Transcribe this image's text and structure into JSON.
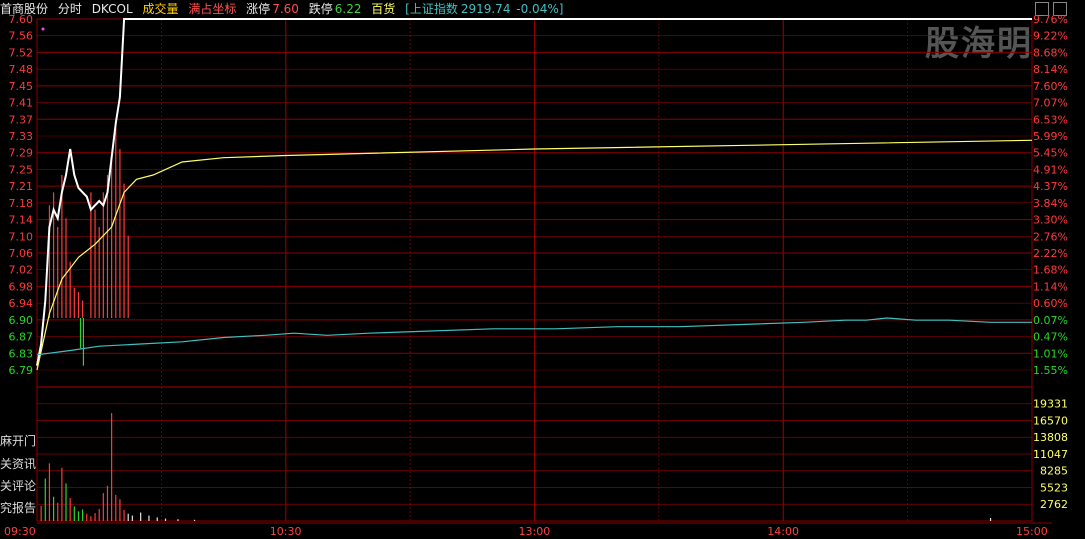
{
  "header": {
    "stock_name": "首商股份",
    "mode": "分时",
    "indicator": "DKCOL",
    "volume_label": "成交量",
    "full_axis": "满占坐标",
    "limit_up_label": "涨停",
    "limit_up": "7.60",
    "limit_down_label": "跌停",
    "limit_down": "6.22",
    "sector": "百货",
    "index_label": "[上证指数",
    "index_value": "2919.74",
    "index_change": "-0.04%]"
  },
  "watermark": "股海明",
  "side_links": [
    "麻开门",
    "关资讯",
    "关评论",
    "究报告"
  ],
  "colors": {
    "background": "#000000",
    "grid": "#8b0000",
    "price_line": "#ffffff",
    "avg_line": "#ffff66",
    "index_line": "#40c0c0",
    "up": "#ff3b3b",
    "down": "#29d629",
    "axis_text_up": "#ff3b3b",
    "axis_text_down": "#29d629",
    "time_text": "#ff4040"
  },
  "chart_data": {
    "type": "line",
    "price_axis": {
      "ticks": [
        "7.60",
        "7.56",
        "7.52",
        "7.48",
        "7.45",
        "7.41",
        "7.37",
        "7.33",
        "7.29",
        "7.25",
        "7.21",
        "7.18",
        "7.14",
        "7.10",
        "7.06",
        "7.02",
        "6.98",
        "6.94",
        "6.90",
        "6.87",
        "6.83",
        "6.79"
      ],
      "ylim": [
        6.79,
        7.6
      ],
      "prev_close": 6.91
    },
    "percent_axis": {
      "ticks": [
        "9.76%",
        "9.22%",
        "8.68%",
        "8.14%",
        "7.60%",
        "7.07%",
        "6.53%",
        "5.99%",
        "5.45%",
        "4.91%",
        "4.37%",
        "3.84%",
        "3.30%",
        "2.76%",
        "2.22%",
        "1.68%",
        "1.14%",
        "0.60%",
        "0.07%",
        "0.47%",
        "1.01%",
        "1.55%"
      ]
    },
    "volume_axis": {
      "ticks": [
        "19331",
        "16570",
        "13808",
        "11047",
        "8285",
        "5523",
        "2762"
      ],
      "ylim": [
        0,
        22092
      ]
    },
    "time_axis": {
      "ticks": [
        "09:30",
        "10:30",
        "13:00",
        "14:00",
        "15:00"
      ],
      "minutes_total": 240
    },
    "series": [
      {
        "key": "price",
        "points": [
          [
            0,
            6.8
          ],
          [
            1,
            6.85
          ],
          [
            2,
            6.95
          ],
          [
            3,
            7.12
          ],
          [
            4,
            7.16
          ],
          [
            5,
            7.14
          ],
          [
            6,
            7.2
          ],
          [
            7,
            7.24
          ],
          [
            8,
            7.3
          ],
          [
            9,
            7.24
          ],
          [
            10,
            7.21
          ],
          [
            11,
            7.2
          ],
          [
            12,
            7.19
          ],
          [
            13,
            7.16
          ],
          [
            14,
            7.17
          ],
          [
            15,
            7.18
          ],
          [
            16,
            7.17
          ],
          [
            17,
            7.2
          ],
          [
            18,
            7.28
          ],
          [
            19,
            7.36
          ],
          [
            20,
            7.42
          ],
          [
            21,
            7.6
          ],
          [
            240,
            7.6
          ]
        ]
      },
      {
        "key": "average",
        "points": [
          [
            0,
            6.79
          ],
          [
            3,
            6.92
          ],
          [
            6,
            7.0
          ],
          [
            10,
            7.05
          ],
          [
            14,
            7.08
          ],
          [
            18,
            7.12
          ],
          [
            21,
            7.2
          ],
          [
            24,
            7.23
          ],
          [
            28,
            7.24
          ],
          [
            35,
            7.27
          ],
          [
            45,
            7.28
          ],
          [
            60,
            7.285
          ],
          [
            120,
            7.3
          ],
          [
            180,
            7.31
          ],
          [
            240,
            7.32
          ]
        ]
      },
      {
        "key": "index",
        "points": [
          [
            0,
            6.825
          ],
          [
            8,
            6.835
          ],
          [
            15,
            6.845
          ],
          [
            25,
            6.85
          ],
          [
            35,
            6.855
          ],
          [
            45,
            6.865
          ],
          [
            55,
            6.87
          ],
          [
            62,
            6.875
          ],
          [
            70,
            6.87
          ],
          [
            80,
            6.875
          ],
          [
            95,
            6.88
          ],
          [
            110,
            6.885
          ],
          [
            125,
            6.885
          ],
          [
            140,
            6.89
          ],
          [
            155,
            6.89
          ],
          [
            170,
            6.895
          ],
          [
            185,
            6.9
          ],
          [
            195,
            6.905
          ],
          [
            200,
            6.905
          ],
          [
            205,
            6.91
          ],
          [
            212,
            6.905
          ],
          [
            220,
            6.905
          ],
          [
            230,
            6.9
          ],
          [
            240,
            6.9
          ]
        ]
      }
    ],
    "dkcol_bars": [
      {
        "t": 3,
        "v": 7.17,
        "c": "up"
      },
      {
        "t": 4,
        "v": 7.2,
        "c": "up"
      },
      {
        "t": 5,
        "v": 7.12,
        "c": "up"
      },
      {
        "t": 6,
        "v": 7.24,
        "c": "up"
      },
      {
        "t": 7,
        "v": 7.14,
        "c": "up"
      },
      {
        "t": 8,
        "v": 7.04,
        "c": "up"
      },
      {
        "t": 9,
        "v": 6.98,
        "c": "up"
      },
      {
        "t": 10,
        "v": 6.97,
        "c": "up"
      },
      {
        "t": 11,
        "v": 6.95,
        "c": "up"
      },
      {
        "t": 10.5,
        "v": 6.84,
        "c": "down"
      },
      {
        "t": 11.2,
        "v": 6.8,
        "c": "down"
      },
      {
        "t": 13,
        "v": 7.2,
        "c": "up"
      },
      {
        "t": 14,
        "v": 7.16,
        "c": "up"
      },
      {
        "t": 15,
        "v": 7.12,
        "c": "up"
      },
      {
        "t": 16,
        "v": 7.2,
        "c": "up"
      },
      {
        "t": 17,
        "v": 7.24,
        "c": "up"
      },
      {
        "t": 18,
        "v": 7.28,
        "c": "up"
      },
      {
        "t": 19,
        "v": 7.35,
        "c": "up"
      },
      {
        "t": 20,
        "v": 7.3,
        "c": "up"
      },
      {
        "t": 21,
        "v": 7.22,
        "c": "up"
      },
      {
        "t": 22,
        "v": 7.1,
        "c": "up"
      }
    ],
    "volume": [
      {
        "t": 1,
        "v": 2500,
        "c": "up"
      },
      {
        "t": 2,
        "v": 7000,
        "c": "down"
      },
      {
        "t": 3,
        "v": 9500,
        "c": "up"
      },
      {
        "t": 4,
        "v": 4000,
        "c": "down"
      },
      {
        "t": 5,
        "v": 3000,
        "c": "up"
      },
      {
        "t": 6,
        "v": 8800,
        "c": "up"
      },
      {
        "t": 7,
        "v": 6200,
        "c": "down"
      },
      {
        "t": 8,
        "v": 3800,
        "c": "up"
      },
      {
        "t": 9,
        "v": 2400,
        "c": "down"
      },
      {
        "t": 10,
        "v": 1600,
        "c": "down"
      },
      {
        "t": 11,
        "v": 1900,
        "c": "down"
      },
      {
        "t": 12,
        "v": 1200,
        "c": "up"
      },
      {
        "t": 13,
        "v": 800,
        "c": "up"
      },
      {
        "t": 14,
        "v": 1300,
        "c": "up"
      },
      {
        "t": 15,
        "v": 2000,
        "c": "up"
      },
      {
        "t": 16,
        "v": 4600,
        "c": "up"
      },
      {
        "t": 17,
        "v": 5800,
        "c": "up"
      },
      {
        "t": 18,
        "v": 17800,
        "c": "up"
      },
      {
        "t": 19,
        "v": 4300,
        "c": "up"
      },
      {
        "t": 20,
        "v": 3600,
        "c": "up"
      },
      {
        "t": 21,
        "v": 1800,
        "c": "up"
      },
      {
        "t": 22,
        "v": 1200,
        "c": "white"
      },
      {
        "t": 23,
        "v": 900,
        "c": "white"
      },
      {
        "t": 25,
        "v": 1400,
        "c": "white"
      },
      {
        "t": 27,
        "v": 900,
        "c": "white"
      },
      {
        "t": 29,
        "v": 600,
        "c": "white"
      },
      {
        "t": 31,
        "v": 400,
        "c": "white"
      },
      {
        "t": 34,
        "v": 300,
        "c": "white"
      },
      {
        "t": 38,
        "v": 200,
        "c": "white"
      },
      {
        "t": 230,
        "v": 500,
        "c": "white"
      }
    ]
  }
}
